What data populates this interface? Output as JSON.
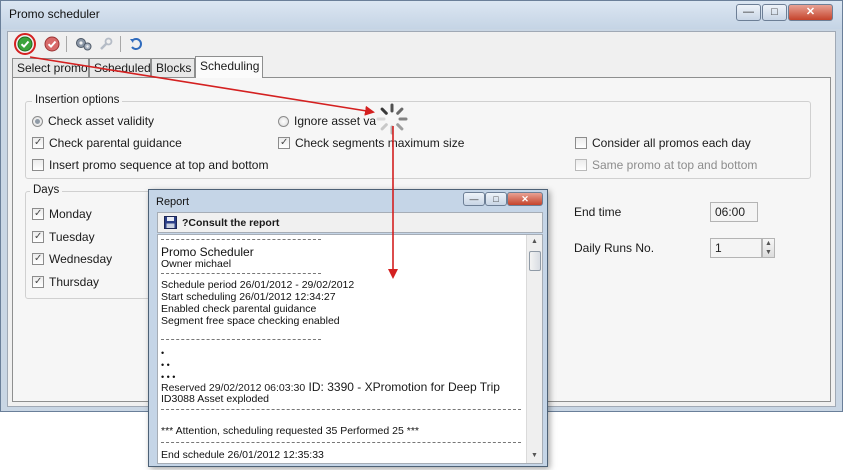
{
  "main_window": {
    "title": "Promo scheduler"
  },
  "tabs": [
    {
      "label": "Select promo"
    },
    {
      "label": "Scheduled"
    },
    {
      "label": "Blocks"
    },
    {
      "label": "Scheduling"
    }
  ],
  "insertion_options": {
    "title": "Insertion options",
    "check_asset_validity": "Check asset validity",
    "ignore_asset_validity": "Ignore asset va",
    "check_parental_guidance": "Check parental guidance",
    "check_segments_max_size": "Check segments maximum size",
    "consider_all_promos": "Consider all promos each day",
    "insert_promo_sequence": "Insert promo sequence at top and bottom",
    "same_promo_top_bottom": "Same promo at top and bottom"
  },
  "days": {
    "title": "Days",
    "items": [
      "Monday",
      "Tuesday",
      "Wednesday",
      "Thursday"
    ]
  },
  "end_time": {
    "label": "End time",
    "value": "06:00"
  },
  "daily_runs": {
    "label": "Daily Runs No.",
    "value": "1"
  },
  "report_window": {
    "title": "Report",
    "toolbar_label": "?Consult the report",
    "lines": {
      "app": "Promo Scheduler",
      "owner": "Owner michael",
      "period": "Schedule period 26/01/2012 - 29/02/2012",
      "start": "Start scheduling 26/01/2012 12:34:27",
      "parental": "Enabled check parental guidance",
      "segment": "Segment free space checking enabled",
      "dot1": "•",
      "dot2": "• •",
      "dot3": "• • •",
      "reserved_a": "Reserved 29/02/2012 06:03:30",
      "reserved_b": "ID: 3390 - XPromotion for Deep Trip",
      "exploded": "ID3088  Asset exploded",
      "attention": "*** Attention, scheduling requested 35 Performed 25 ***",
      "end": "End schedule 26/01/2012 12:35:33"
    }
  },
  "colors": {
    "annotation_arrow": "#d42020",
    "window_frame": "#c9d6e4",
    "report_frame": "#c5d5e7"
  }
}
